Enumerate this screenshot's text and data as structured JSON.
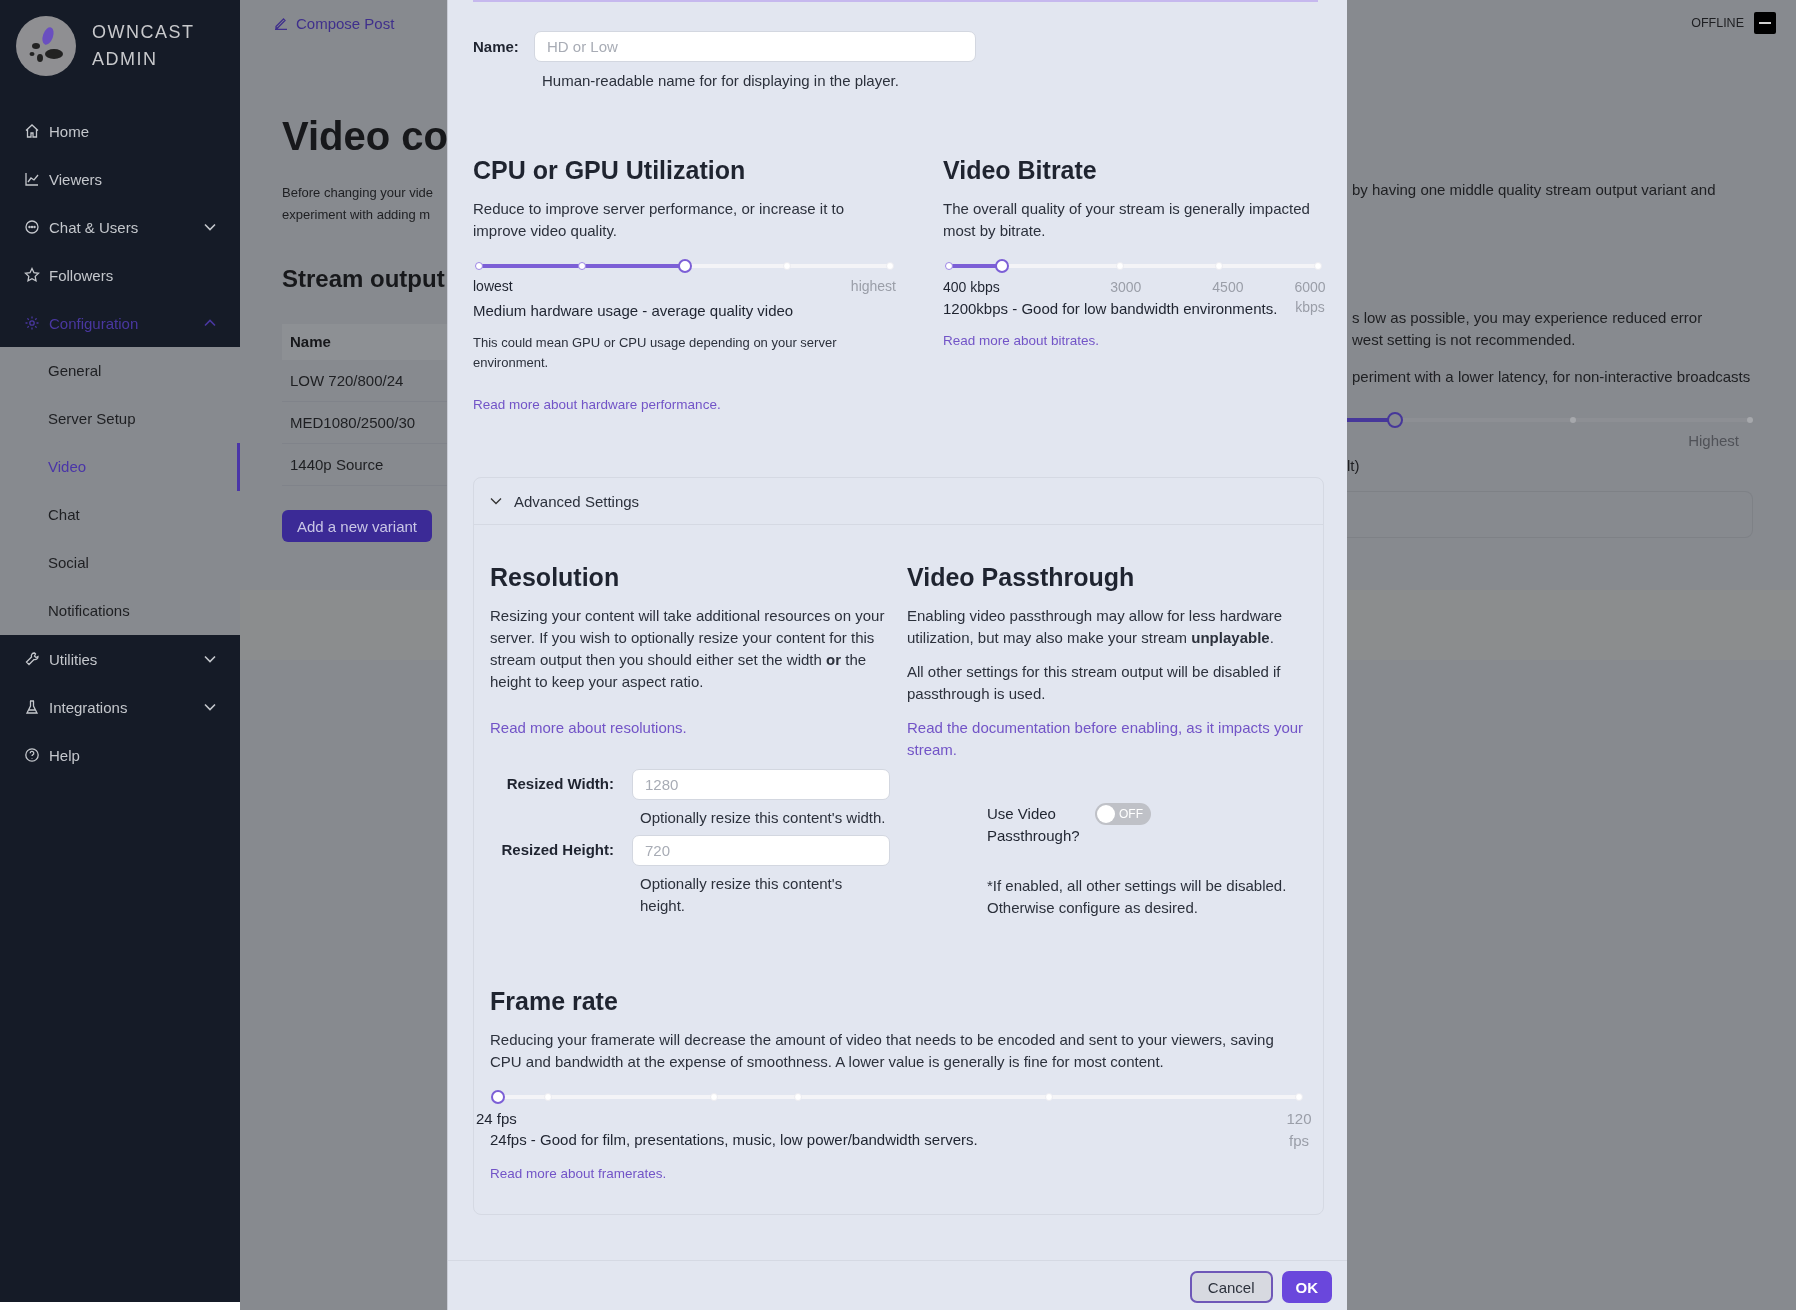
{
  "sidebar": {
    "logo_text": [
      "OWNCAST",
      "ADMIN"
    ],
    "items": [
      {
        "label": "Home"
      },
      {
        "label": "Viewers"
      },
      {
        "label": "Chat & Users",
        "expanded": false
      },
      {
        "label": "Followers"
      },
      {
        "label": "Configuration",
        "expanded": true,
        "children": [
          {
            "label": "General",
            "selected": false
          },
          {
            "label": "Server Setup",
            "selected": false
          },
          {
            "label": "Video",
            "selected": true
          },
          {
            "label": "Chat",
            "selected": false
          },
          {
            "label": "Social",
            "selected": false
          },
          {
            "label": "Notifications",
            "selected": false
          }
        ]
      },
      {
        "label": "Utilities",
        "expanded": false
      },
      {
        "label": "Integrations",
        "expanded": false
      },
      {
        "label": "Help"
      }
    ]
  },
  "top_bar": {
    "compose_button": "Compose Post",
    "status": "OFFLINE"
  },
  "page": {
    "title": "Video co",
    "intro": [
      "Before changing your vide",
      "experiment with adding m"
    ],
    "section_title": "Stream output",
    "table": {
      "columns": [
        "Name"
      ],
      "rows": [
        [
          "LOW 720/800/24"
        ],
        [
          "MED1080/2500/30"
        ],
        [
          "1440p Source"
        ]
      ]
    },
    "add_button": "Add a new variant",
    "right_texts": [
      "by having one middle quality stream output variant and",
      "s low as possible, you may experience reduced error",
      "west setting is not recommended.",
      "periment with a lower latency, for non-interactive broadcasts"
    ],
    "latency_slider": {
      "level": 0.12,
      "max_label": "Highest",
      "reading": "lt)"
    }
  },
  "modal": {
    "name_field": {
      "label": "Name:",
      "placeholder": "HD or Low",
      "help": "Human-readable name for for displaying in the player."
    },
    "cpu": {
      "title": "CPU or GPU Utilization",
      "description": "Reduce to improve server performance, or increase it to improve video quality.",
      "level": 0.5,
      "min_label": "lowest",
      "max_label": "highest",
      "reading": "Medium hardware usage - average quality video",
      "note": "This could mean GPU or CPU usage depending on your server environment.",
      "link": "Read more about hardware performance."
    },
    "bitrate": {
      "title": "Video Bitrate",
      "description": "The overall quality of your stream is generally impacted most by bitrate.",
      "level": 0.143,
      "tick_labels": [
        "400 kbps",
        "3000",
        "4500",
        "6000 kbps"
      ],
      "reading": "1200kbps - Good for low bandwidth environments.",
      "link": "Read more about bitrates."
    },
    "advanced": {
      "title": "Advanced Settings",
      "expanded": true,
      "resolution": {
        "title": "Resolution",
        "description": "Resizing your content will take additional resources on your server. If you wish to optionally resize your content for this stream output then you should either set the width **or** the height to keep your aspect ratio.",
        "link": "Read more about resolutions.",
        "fields": [
          {
            "label": "Resized Width:",
            "placeholder": "1280",
            "help": "Optionally resize this content's width."
          },
          {
            "label": "Resized Height:",
            "placeholder": "720",
            "help": "Optionally resize this content's height."
          }
        ]
      },
      "passthrough": {
        "title": "Video Passthrough",
        "description": "Enabling video passthrough may allow for less hardware utilization, but may also make your stream **unplayable**.",
        "note": "All other settings for this stream output will be disabled if passthrough is used.",
        "link": "Read the documentation before enabling, as it impacts your stream.",
        "toggle_label": "Use Video Passthrough?",
        "toggle": {
          "on": false,
          "text": "OFF"
        },
        "toggle_note": "*If enabled, all other settings will be disabled. Otherwise configure as desired."
      },
      "framerate": {
        "title": "Frame rate",
        "description": "Reducing your framerate will decrease the amount of video that needs to be encoded and sent to your viewers, saving CPU and bandwidth at the expense of smoothness. A lower value is generally is fine for most content.",
        "level": 0,
        "min_label": "24 fps",
        "max_label": "120 fps",
        "reading": "24fps - Good for film, presentations, music, low power/bandwidth servers.",
        "link": "Read more about framerates."
      }
    },
    "buttons": [
      {
        "label": "Cancel",
        "kind": "secondary"
      },
      {
        "label": "OK",
        "kind": "primary"
      }
    ]
  }
}
